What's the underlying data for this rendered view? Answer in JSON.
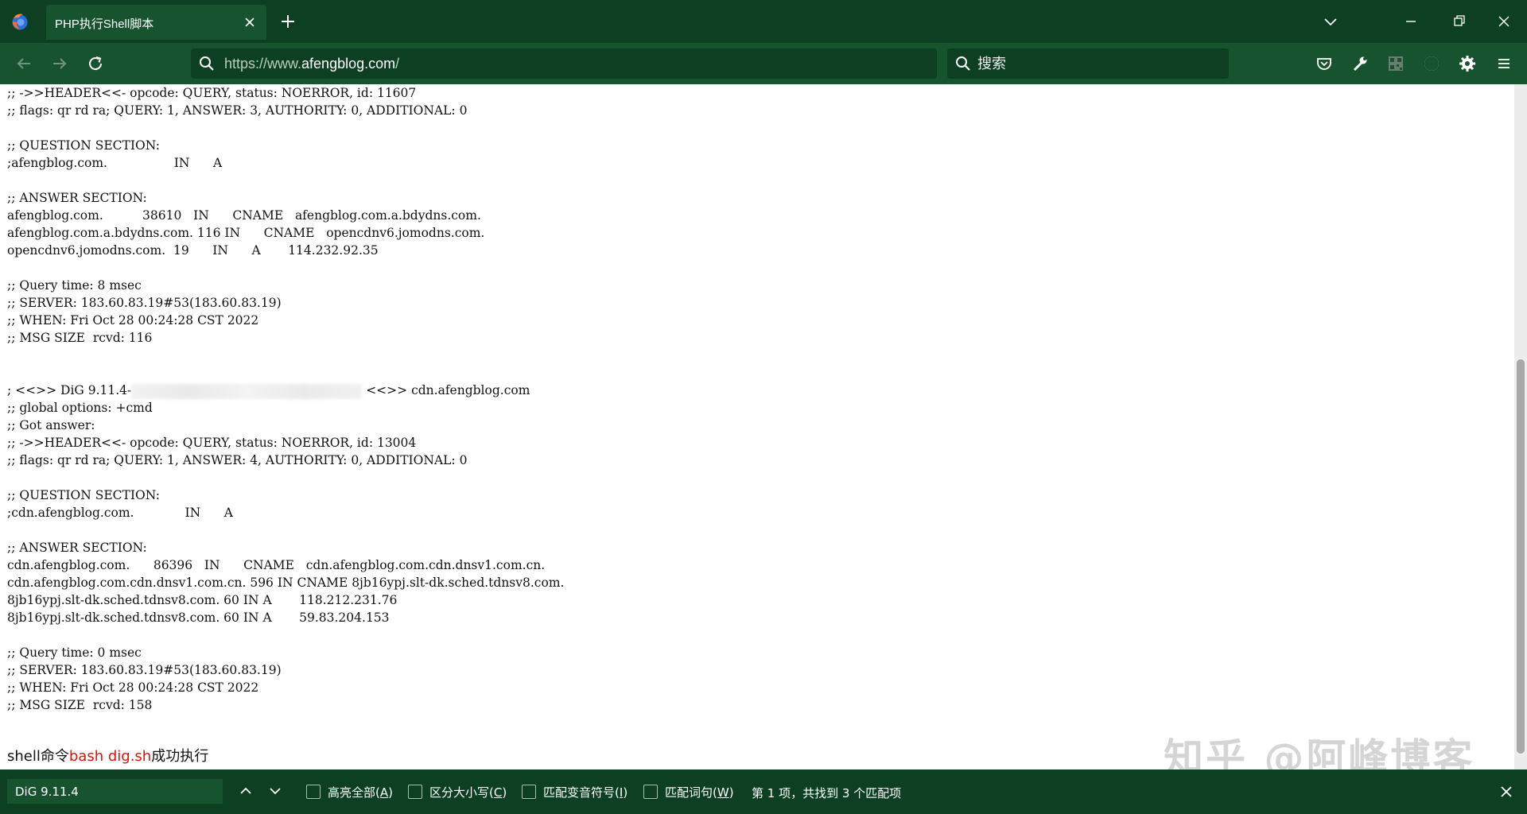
{
  "colors": {
    "frame": "#0d3f23",
    "toolbar": "#17532f",
    "text": "#111111",
    "command_highlight": "#d0180e",
    "watermark": "#c4c4c4"
  },
  "window": {
    "tab_title": "PHP执行Shell脚本",
    "controls": [
      "list-tabs-icon",
      "minimize-icon",
      "restore-icon",
      "close-icon"
    ]
  },
  "navbar": {
    "url_prefix": "https://www.",
    "url_domain": "afengblog.com",
    "url_suffix": "/",
    "search_placeholder": "搜索",
    "toolbar_icons": [
      "pocket-icon",
      "devtools-wrench-icon",
      "qr-code-icon",
      "extension-icon",
      "settings-gear-icon",
      "menu-icon"
    ]
  },
  "output": {
    "lines": [
      ";; ->>HEADER<<- opcode: QUERY, status: NOERROR, id: 11607",
      ";; flags: qr rd ra; QUERY: 1, ANSWER: 3, AUTHORITY: 0, ADDITIONAL: 0",
      "",
      ";; QUESTION SECTION:",
      ";afengblog.com.                 IN      A",
      "",
      ";; ANSWER SECTION:",
      "afengblog.com.          38610   IN      CNAME   afengblog.com.a.bdydns.com.",
      "afengblog.com.a.bdydns.com. 116 IN      CNAME   opencdnv6.jomodns.com.",
      "opencdnv6.jomodns.com.  19      IN      A       114.232.92.35",
      "",
      ";; Query time: 8 msec",
      ";; SERVER: 183.60.83.19#53(183.60.83.19)",
      ";; WHEN: Fri Oct 28 00:24:28 CST 2022",
      ";; MSG SIZE  rcvd: 116",
      "",
      "",
      "__DIG_HEADER__",
      ";; global options: +cmd",
      ";; Got answer:",
      ";; ->>HEADER<<- opcode: QUERY, status: NOERROR, id: 13004",
      ";; flags: qr rd ra; QUERY: 1, ANSWER: 4, AUTHORITY: 0, ADDITIONAL: 0",
      "",
      ";; QUESTION SECTION:",
      ";cdn.afengblog.com.             IN      A",
      "",
      ";; ANSWER SECTION:",
      "cdn.afengblog.com.      86396   IN      CNAME   cdn.afengblog.com.cdn.dnsv1.com.cn.",
      "cdn.afengblog.com.cdn.dnsv1.com.cn. 596 IN CNAME 8jb16ypj.slt-dk.sched.tdnsv8.com.",
      "8jb16ypj.slt-dk.sched.tdnsv8.com. 60 IN A       118.212.231.76",
      "8jb16ypj.slt-dk.sched.tdnsv8.com. 60 IN A       59.83.204.153",
      "",
      ";; Query time: 0 msec",
      ";; SERVER: 183.60.83.19#53(183.60.83.19)",
      ";; WHEN: Fri Oct 28 00:24:28 CST 2022",
      ";; MSG SIZE  rcvd: 158"
    ],
    "dig_header_prefix": "; <<>> DiG 9.11.4-",
    "dig_header_suffix": " <<>> cdn.afengblog.com"
  },
  "caption": {
    "prefix": "shell命令",
    "command": "bash dig.sh",
    "suffix": "成功执行"
  },
  "watermark": "知乎 @阿峰博客",
  "findbar": {
    "query": "DiG 9.11.4",
    "options": [
      {
        "label": "高亮全部",
        "accel": "A",
        "checked": false
      },
      {
        "label": "区分大小写",
        "accel": "C",
        "checked": false
      },
      {
        "label": "匹配变音符号",
        "accel": "I",
        "checked": false
      },
      {
        "label": "匹配词句",
        "accel": "W",
        "checked": false
      }
    ],
    "status": "第 1 项，共找到 3 个匹配项"
  }
}
